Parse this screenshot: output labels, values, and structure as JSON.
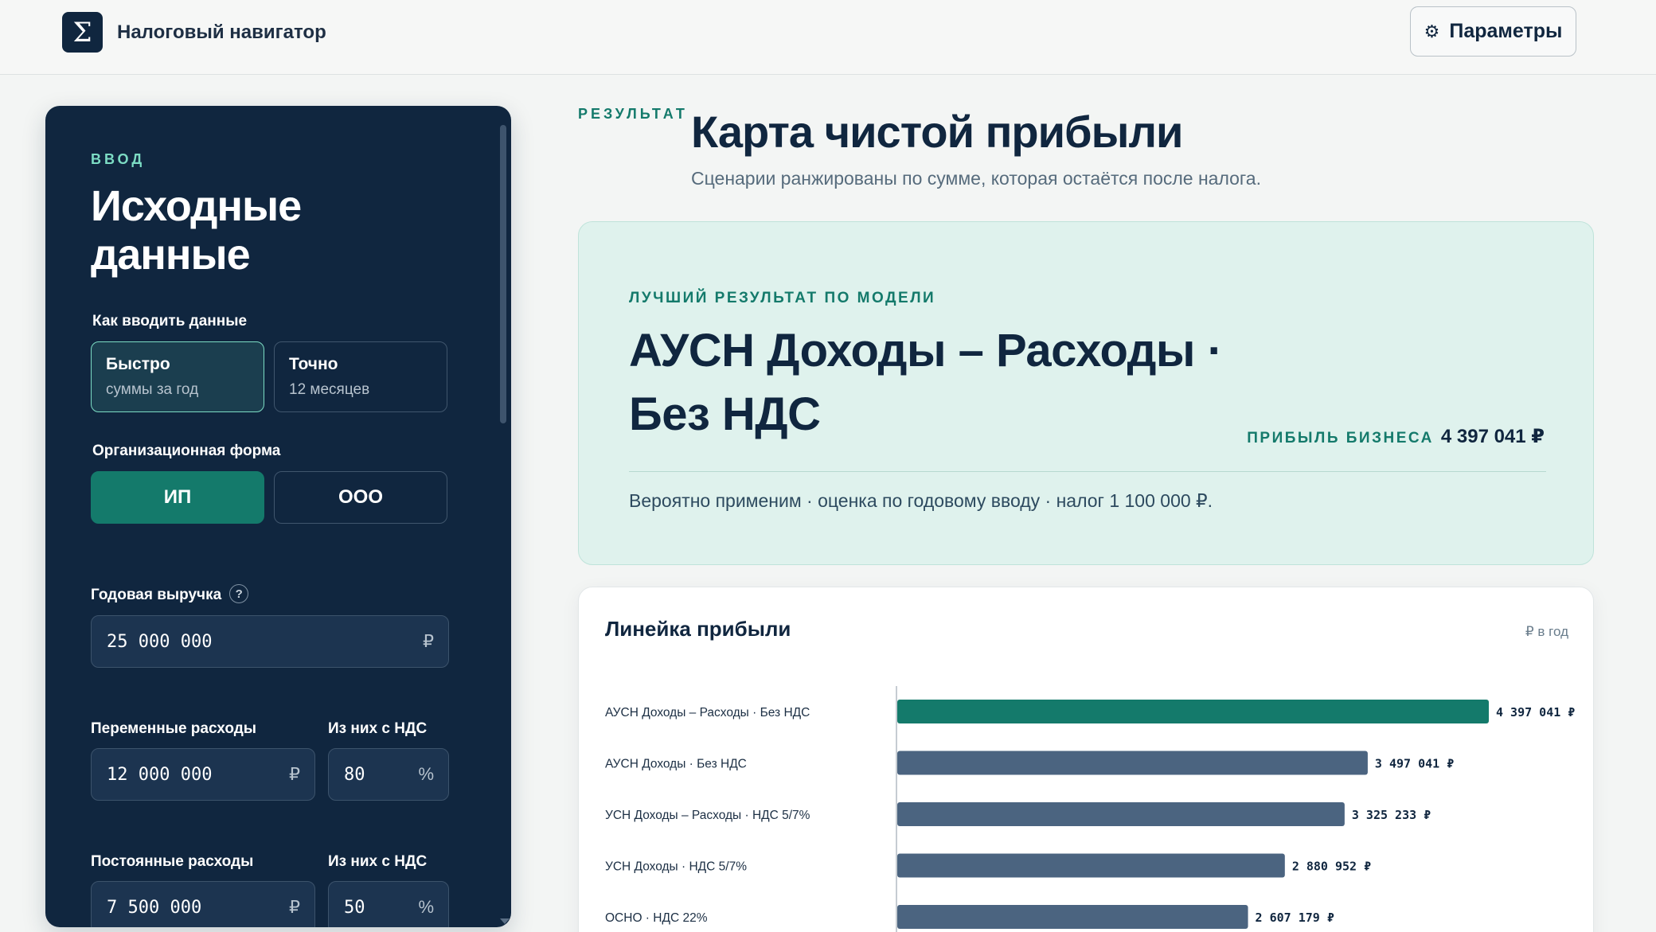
{
  "header": {
    "logo_glyph": "Σ",
    "app_title": "Налоговый навигатор",
    "params_icon": "⚙",
    "params_label": "Параметры"
  },
  "input_panel": {
    "eyebrow": "ВВОД",
    "title": "Исходные данные",
    "mode_label": "Как вводить данные",
    "modes": [
      {
        "title": "Быстро",
        "subtitle": "суммы за год",
        "active": true
      },
      {
        "title": "Точно",
        "subtitle": "12 месяцев",
        "active": false
      }
    ],
    "org_label": "Организационная форма",
    "org_options": [
      {
        "label": "ИП",
        "active": true
      },
      {
        "label": "ООО",
        "active": false
      }
    ],
    "revenue": {
      "label": "Годовая выручка",
      "help": "?",
      "value": "25 000 000",
      "unit": "₽"
    },
    "variable": {
      "label": "Переменные расходы",
      "value": "12 000 000",
      "unit": "₽",
      "vat_label": "Из них с НДС",
      "vat_value": "80",
      "vat_unit": "%"
    },
    "fixed": {
      "label": "Постоянные расходы",
      "value": "7 500 000",
      "unit": "₽",
      "vat_label": "Из них с НДС",
      "vat_value": "50",
      "vat_unit": "%"
    }
  },
  "result": {
    "eyebrow": "РЕЗУЛЬТАТ",
    "title": "Карта чистой прибыли",
    "subtitle": "Сценарии ранжированы по сумме, которая остаётся после налога.",
    "best": {
      "eyebrow": "ЛУЧШИЙ РЕЗУЛЬТАТ ПО МОДЕЛИ",
      "name": "АУСН Доходы – Расходы · Без НДС",
      "profit_label": "ПРИБЫЛЬ БИЗНЕСА",
      "profit_value": "4 397 041 ₽",
      "note": "Вероятно применим · оценка по годовому вводу · налог 1 100 000 ₽."
    },
    "ruler": {
      "title": "Линейка прибыли",
      "unit": "₽ в год"
    }
  },
  "colors": {
    "navy": "#10263f",
    "teal": "#147a6b",
    "mint": "#7cdcc4",
    "bar_default": "#4b6480",
    "best_card_bg": "#dff2ed"
  },
  "chart_data": {
    "type": "bar",
    "orientation": "horizontal",
    "title": "Линейка прибыли",
    "unit_label": "₽ в год",
    "categories": [
      "АУСН Доходы – Расходы · Без НДС",
      "АУСН Доходы · Без НДС",
      "УСН Доходы – Расходы · НДС 5/7%",
      "УСН Доходы · НДС 5/7%",
      "ОСНО · НДС 22%"
    ],
    "values": [
      4397041,
      3497041,
      3325233,
      2880952,
      2607179
    ],
    "value_labels": [
      "4 397 041 ₽",
      "3 497 041 ₽",
      "3 325 233 ₽",
      "2 880 952 ₽",
      "2 607 179 ₽"
    ],
    "highlight_index": 0,
    "xlim": [
      0,
      4397041
    ]
  }
}
